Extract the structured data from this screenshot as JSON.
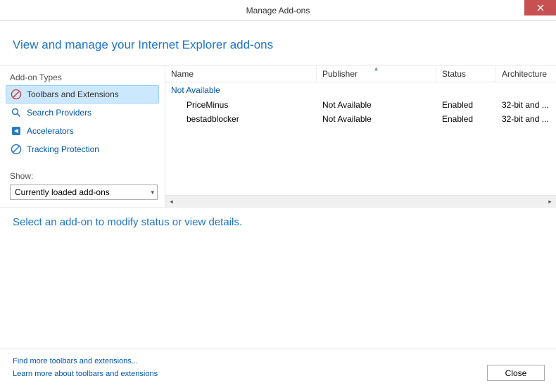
{
  "titlebar": {
    "title": "Manage Add-ons"
  },
  "heading": "View and manage your Internet Explorer add-ons",
  "sidebar": {
    "types_label": "Add-on Types",
    "items": [
      {
        "label": "Toolbars and Extensions"
      },
      {
        "label": "Search Providers"
      },
      {
        "label": "Accelerators"
      },
      {
        "label": "Tracking Protection"
      }
    ],
    "show_label": "Show:",
    "show_value": "Currently loaded add-ons"
  },
  "list": {
    "columns": {
      "name": "Name",
      "publisher": "Publisher",
      "status": "Status",
      "architecture": "Architecture"
    },
    "group": "Not Available",
    "rows": [
      {
        "name": "PriceMinus",
        "publisher": "Not Available",
        "status": "Enabled",
        "architecture": "32-bit and ..."
      },
      {
        "name": "bestadblocker",
        "publisher": "Not Available",
        "status": "Enabled",
        "architecture": "32-bit and ..."
      }
    ]
  },
  "details": {
    "prompt": "Select an add-on to modify status or view details."
  },
  "footer": {
    "link1": "Find more toolbars and extensions...",
    "link2": "Learn more about toolbars and extensions",
    "close": "Close"
  }
}
